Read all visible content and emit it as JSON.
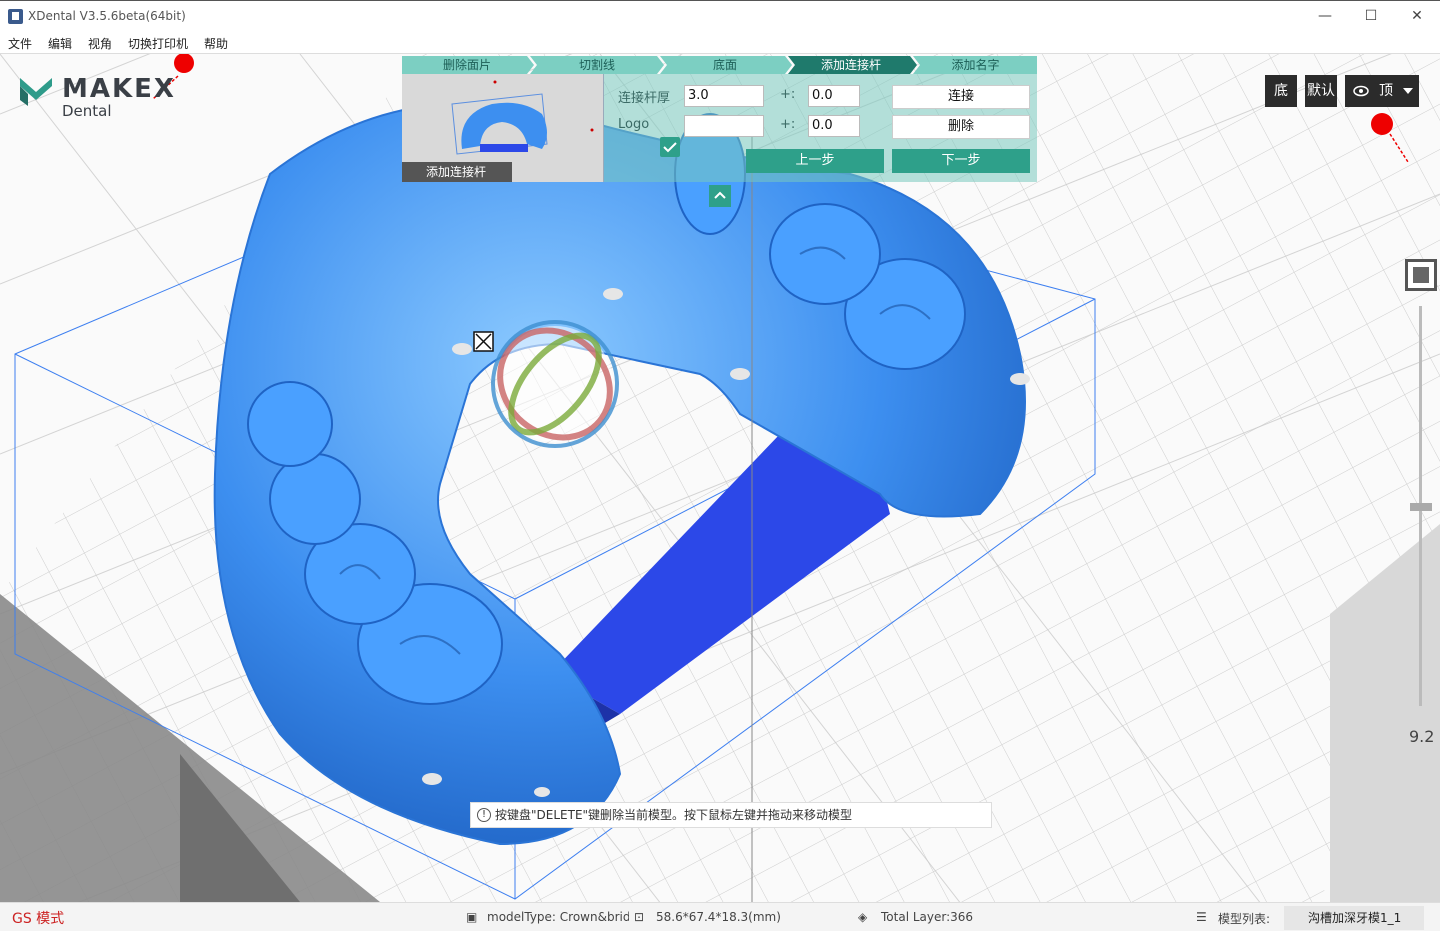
{
  "window": {
    "title": "XDental V3.5.6beta(64bit)",
    "minimize": "—",
    "maximize": "☐",
    "close": "✕"
  },
  "menu": [
    "文件",
    "编辑",
    "视角",
    "切换打印机",
    "帮助"
  ],
  "logo": {
    "brand": "MAKEX",
    "sub": "Dental"
  },
  "steps": [
    {
      "label": "删除面片",
      "active": false
    },
    {
      "label": "切割线",
      "active": false
    },
    {
      "label": "底面",
      "active": false
    },
    {
      "label": "添加连接杆",
      "active": true
    },
    {
      "label": "添加名字",
      "active": false
    }
  ],
  "panel": {
    "thumbnail_label": "添加连接杆",
    "thickness_label": "连接杆厚",
    "thickness_value": "3.0",
    "logo_label": "Logo",
    "logo_checked": true,
    "logo_value": "",
    "offset1_label": "+:",
    "offset1_value": "0.0",
    "offset2_label": "+:",
    "offset2_value": "0.0",
    "connect_button": "连接",
    "delete_button": "删除",
    "prev_button": "上一步",
    "next_button": "下一步",
    "collapse_icon": "chevron-up-icon"
  },
  "view_buttons": {
    "bottom": "底",
    "default": "默认",
    "top": "顶"
  },
  "layer_slider": {
    "value": "9.2"
  },
  "hint": {
    "text": "按键盘\"DELETE\"键删除当前模型。按下鼠标左键并拖动来移动模型"
  },
  "status": {
    "mode": "GS 模式",
    "model_type": "modelType: Crown&bridge",
    "dimensions": "58.6*67.4*18.3(mm)",
    "total_layer": "Total Layer:366",
    "model_list_label": "模型列表:",
    "model_list_value": "沟槽加深牙模1_1"
  },
  "colors": {
    "accent": "#2ea08a",
    "model": "#3d8ff0",
    "connector": "#2c48e8",
    "mode_text": "#cc2222"
  }
}
